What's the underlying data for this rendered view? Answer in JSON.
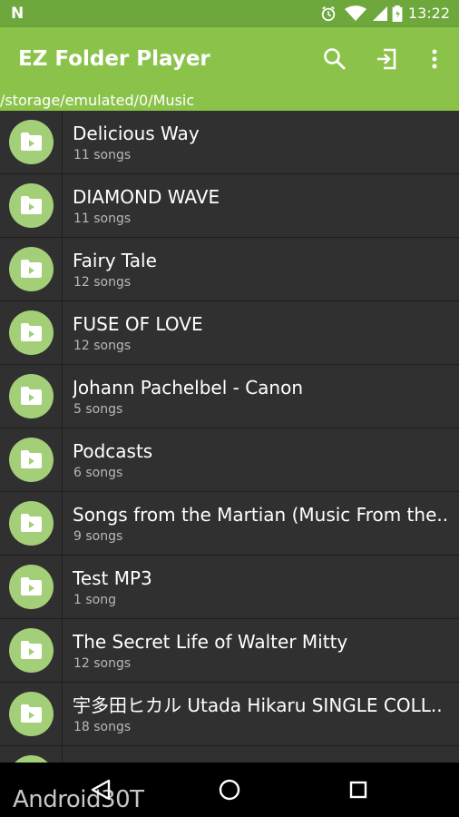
{
  "status_bar": {
    "time": "13:22",
    "icons": [
      "n-logo-icon",
      "alarm-icon",
      "wifi-icon",
      "battery-icon"
    ]
  },
  "app_bar": {
    "title": "EZ Folder Player",
    "actions": [
      "search-icon",
      "login-icon",
      "more-vert-icon"
    ]
  },
  "path": "/storage/emulated/0/Music",
  "folders": [
    {
      "name": "Delicious Way",
      "count": "11 songs"
    },
    {
      "name": "DIAMOND WAVE",
      "count": "11 songs"
    },
    {
      "name": "Fairy Tale",
      "count": "12 songs"
    },
    {
      "name": "FUSE OF LOVE",
      "count": "12 songs"
    },
    {
      "name": "Johann Pachelbel - Canon",
      "count": "5 songs"
    },
    {
      "name": "Podcasts",
      "count": "6 songs"
    },
    {
      "name": "Songs from the Martian (Music From the..",
      "count": "9 songs"
    },
    {
      "name": "Test MP3",
      "count": "1 song"
    },
    {
      "name": "The Secret Life of Walter Mitty",
      "count": "12 songs"
    },
    {
      "name": "宇多田ヒカル Utada Hikaru SINGLE COLL..",
      "count": "18 songs"
    }
  ],
  "nav_bar": {
    "buttons": [
      "back-icon",
      "home-icon",
      "recents-icon"
    ]
  },
  "watermark": "Android30T",
  "colors": {
    "status_bar": "#6ea83c",
    "app_bar": "#8bc34a",
    "list_bg": "#303030",
    "folder_circle": "#a4cf79",
    "subtext": "#b8b8b8"
  }
}
